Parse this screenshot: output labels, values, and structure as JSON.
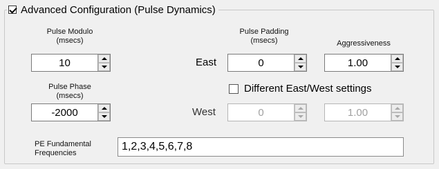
{
  "group": {
    "title": "Advanced Configuration (Pulse Dynamics)",
    "checked": true
  },
  "pulse_modulo": {
    "label_line1": "Pulse Modulo",
    "label_line2": "(msecs)",
    "value": "10"
  },
  "pulse_phase": {
    "label_line1": "Pulse Phase",
    "label_line2": "(msecs)",
    "value": "-2000"
  },
  "pulse_padding": {
    "label_line1": "Pulse Padding",
    "label_line2": "(msecs)"
  },
  "aggressiveness": {
    "label": "Aggressiveness"
  },
  "east": {
    "label": "East",
    "padding_value": "0",
    "aggressiveness_value": "1.00"
  },
  "west": {
    "label": "West",
    "padding_value": "0",
    "aggressiveness_value": "1.00",
    "enabled": false
  },
  "different_settings": {
    "label": "Different East/West settings",
    "checked": false
  },
  "pe_frequencies": {
    "label_line1": "PE Fundamental",
    "label_line2": "Frequencies",
    "value": "1,2,3,4,5,6,7,8"
  }
}
